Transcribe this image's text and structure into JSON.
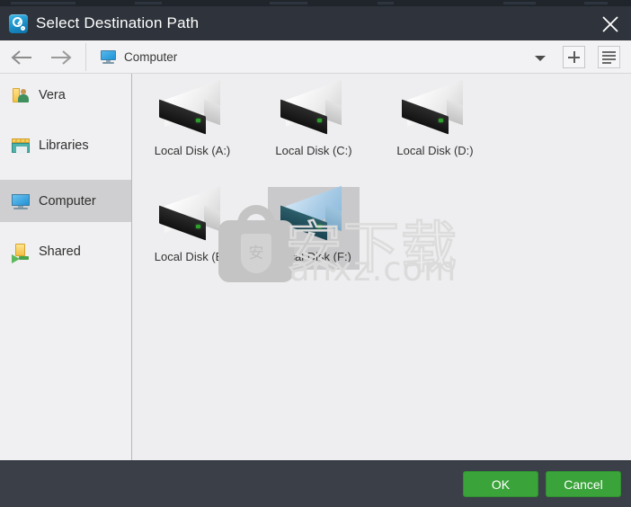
{
  "window": {
    "title": "Select Destination Path",
    "app_icon": "clock-gear-icon",
    "close_icon": "close-icon",
    "titlebar_color": "#2f343c",
    "footer_color": "#3a3f48",
    "accent_color": "#3aa33a"
  },
  "toolbar": {
    "back_icon": "arrow-left-icon",
    "forward_icon": "arrow-right-icon",
    "breadcrumb": {
      "icon": "computer-monitor-icon",
      "label": "Computer"
    },
    "dropdown_icon": "chevron-down-icon",
    "new_folder_icon": "plus-icon",
    "view_mode_icon": "list-view-icon"
  },
  "sidebar": {
    "items": [
      {
        "label": "Vera",
        "icon": "user-folder-icon",
        "selected": false
      },
      {
        "label": "Libraries",
        "icon": "libraries-icon",
        "selected": false
      },
      {
        "label": "Computer",
        "icon": "computer-monitor-icon",
        "selected": true
      },
      {
        "label": "Shared",
        "icon": "shared-folder-icon",
        "selected": false
      }
    ]
  },
  "main": {
    "items": [
      {
        "label": "Local Disk (A:)",
        "icon": "hard-drive-icon",
        "selected": false
      },
      {
        "label": "Local Disk (C:)",
        "icon": "hard-drive-icon",
        "selected": false
      },
      {
        "label": "Local Disk (D:)",
        "icon": "hard-drive-icon",
        "selected": false
      },
      {
        "label": "Local Disk (E:)",
        "icon": "hard-drive-icon",
        "selected": false
      },
      {
        "label": "Local Disk (F:)",
        "icon": "hard-drive-icon",
        "selected": true
      }
    ]
  },
  "watermark": {
    "logo_glyph": "安",
    "characters": "安下载",
    "url": "anxz.com"
  },
  "footer": {
    "ok_label": "OK",
    "cancel_label": "Cancel"
  }
}
